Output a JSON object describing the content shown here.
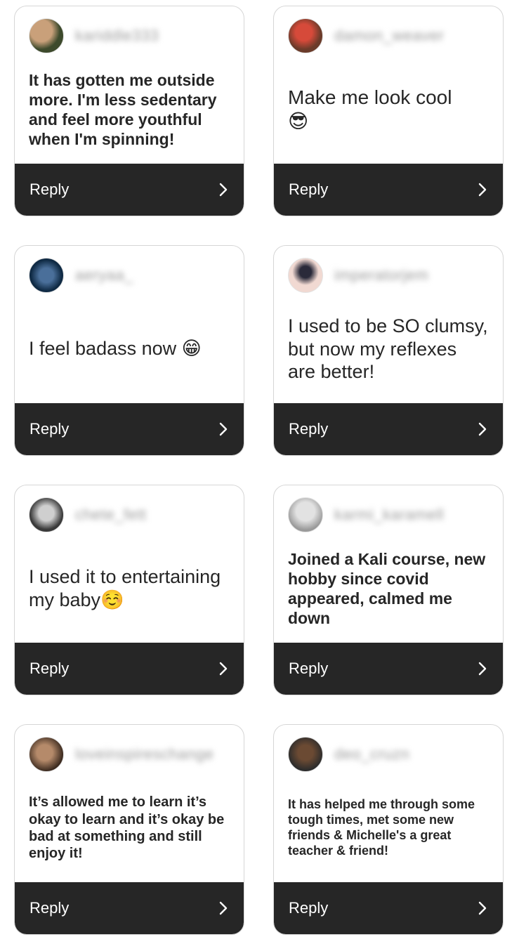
{
  "cards": [
    {
      "username": "kariddle333",
      "text": "It has gotten me outside more. I'm less sedentary and feel more youthful when I'm spinning!",
      "emoji": "",
      "reply_label": "Reply",
      "avatar_colors": [
        "#c9a07a",
        "#3d4a2c"
      ]
    },
    {
      "username": "damon_weaver",
      "text": "Make me look cool",
      "emoji": "😎",
      "reply_label": "Reply",
      "avatar_colors": [
        "#d64a3a",
        "#6b3b2a"
      ]
    },
    {
      "username": "aeryaa_",
      "text": "I feel badass now",
      "emoji": "😁",
      "reply_label": "Reply",
      "avatar_colors": [
        "#4a6f9a",
        "#0f2a44"
      ]
    },
    {
      "username": "imperatorjem",
      "text": "I used to be SO clumsy, but now my reflexes are better!",
      "emoji": "",
      "reply_label": "Reply",
      "avatar_colors": [
        "#f1d9d2",
        "#2a2a3a"
      ]
    },
    {
      "username": "chete_fett",
      "text": "I used it to entertaining my baby",
      "emoji": "☺️",
      "reply_label": "Reply",
      "avatar_colors": [
        "#cfcfcf",
        "#3a3a3a"
      ]
    },
    {
      "username": "karmi_karamell",
      "text": "Joined a Kali course, new hobby since covid appeared, calmed me down",
      "emoji": "",
      "reply_label": "Reply",
      "avatar_colors": [
        "#e2e2e2",
        "#9a9a9a"
      ]
    },
    {
      "username": "loveinspireschange",
      "text": "It’s allowed me to learn it’s okay to learn and it’s okay be bad at something and still enjoy it!",
      "emoji": "",
      "reply_label": "Reply",
      "avatar_colors": [
        "#b58a6a",
        "#3b2a1f"
      ]
    },
    {
      "username": "deo_cruzn",
      "text": "It has helped me through some tough times, met some new friends & Michelle's a great teacher & friend!",
      "emoji": "",
      "reply_label": "Reply",
      "avatar_colors": [
        "#3a3a3a",
        "#6b4a33"
      ]
    }
  ]
}
